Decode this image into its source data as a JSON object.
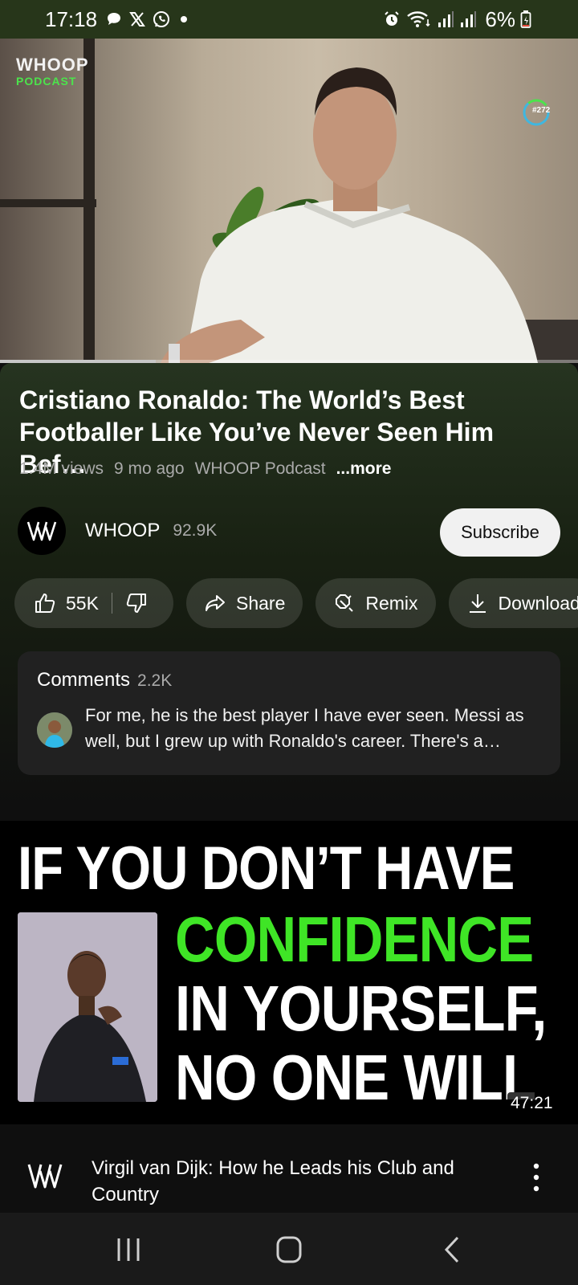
{
  "status_bar": {
    "time": "17:18",
    "battery": "6%",
    "left_icons": [
      "chat-bubble-icon",
      "x-logo-icon",
      "whatsapp-icon",
      "dot-icon"
    ],
    "right_icons": [
      "alarm-icon",
      "wifi-icon",
      "signal-icon",
      "signal-icon",
      "battery-icon"
    ]
  },
  "player": {
    "logo_line1": "WHOOP",
    "logo_line2": "PODCAST",
    "episode_badge": "#272",
    "progress": 0.27,
    "colors": {
      "logo_green": "#4ce34c",
      "progress": "#c8c8c8"
    }
  },
  "video": {
    "title": "Cristiano Ronaldo: The World’s Best Footballer Like You’ve Never Seen Him Bef…",
    "views": "1.4M views",
    "age": "9 mo ago",
    "channel_tag": "WHOOP Podcast",
    "more": "...more"
  },
  "channel": {
    "name": "WHOOP",
    "subscribers": "92.9K",
    "subscribe_label": "Subscribe"
  },
  "actions": {
    "likes": "55K",
    "share": "Share",
    "remix": "Remix",
    "download": "Download"
  },
  "comments": {
    "label": "Comments",
    "count": "2.2K",
    "top_comment": "For me, he is the best player I have ever seen. Messi as well, but I grew up with Ronaldo's career. There's a…"
  },
  "next_video": {
    "thumb_line1": "IF YOU DON’T HAVE",
    "thumb_line2": "CONFIDENCE",
    "thumb_line3": "IN YOURSELF,",
    "thumb_line4": "NO ONE WILL",
    "duration": "47:21",
    "title": "Virgil van Dijk: How he Leads his Club and Country",
    "colors": {
      "highlight": "#3fe526"
    }
  },
  "nav_bar": {
    "buttons": [
      "recent-apps-icon",
      "home-icon",
      "back-icon"
    ]
  }
}
